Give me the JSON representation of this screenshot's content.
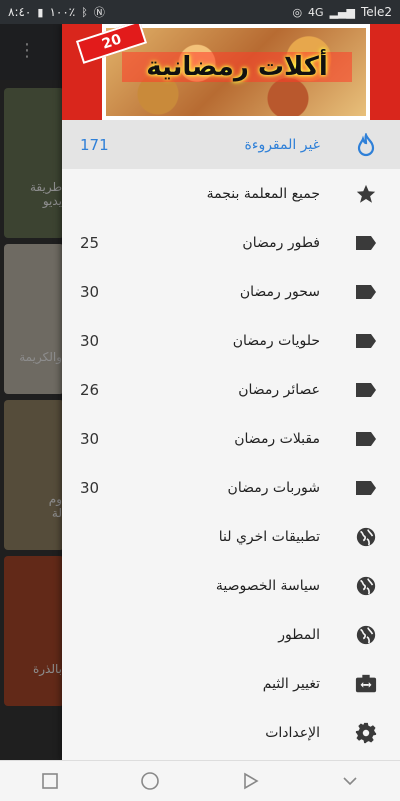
{
  "status_bar": {
    "time": "٨:٤٠",
    "battery": "١٠٠٪",
    "carrier": "Tele2",
    "signal_label": "4G"
  },
  "background_cards": [
    {
      "text": "طريقة\nيديو",
      "color": "#6d7a5a"
    },
    {
      "text": "والكريمة",
      "color": "#c9c1b3"
    },
    {
      "text": "وم\nلة",
      "color": "#9c8a6a"
    },
    {
      "text": "بالذرة",
      "color": "#b34b2c"
    }
  ],
  "drawer": {
    "header_title": "أكلات رمضانية",
    "header_badge": "20",
    "accent_color": "#2f80d8",
    "items": [
      {
        "label": "غير المقروءة",
        "count": "171",
        "icon": "flame-icon",
        "selected": true
      },
      {
        "label": "جميع المعلمة بنجمة",
        "count": "",
        "icon": "star-icon"
      },
      {
        "label": "فطور رمضان",
        "count": "25",
        "icon": "label-tag-icon"
      },
      {
        "label": "سحور رمضان",
        "count": "30",
        "icon": "label-tag-icon"
      },
      {
        "label": "حلويات رمضان",
        "count": "30",
        "icon": "label-tag-icon"
      },
      {
        "label": "عصائر رمضان",
        "count": "26",
        "icon": "label-tag-icon"
      },
      {
        "label": "مقبلات رمضان",
        "count": "30",
        "icon": "label-tag-icon"
      },
      {
        "label": "شوربات رمضان",
        "count": "30",
        "icon": "label-tag-icon"
      },
      {
        "label": "تطبيقات اخري لنا",
        "count": "",
        "icon": "globe-icon"
      },
      {
        "label": "سياسة الخصوصية",
        "count": "",
        "icon": "globe-icon"
      },
      {
        "label": "المطور",
        "count": "",
        "icon": "globe-icon"
      },
      {
        "label": "تغيير الثيم",
        "count": "",
        "icon": "theme-switch-icon"
      },
      {
        "label": "الإعدادات",
        "count": "",
        "icon": "gear-icon"
      }
    ]
  },
  "nav_bar": {
    "buttons": [
      "recents-square-icon",
      "home-circle-icon",
      "back-triangle-icon",
      "collapse-chevron-icon"
    ]
  }
}
